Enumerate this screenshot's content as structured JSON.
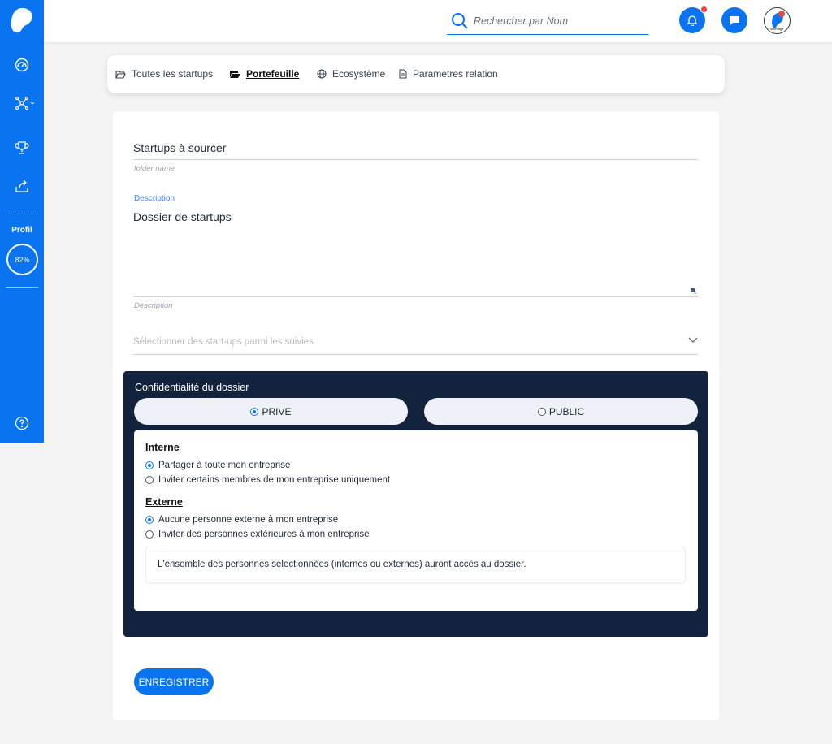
{
  "colors": {
    "brand_blue": "#0a73f0",
    "panel_navy": "#13233d",
    "notification_red": "#ef4444"
  },
  "sidebar": {
    "items": [
      {
        "icon": "dashboard-gauge-icon"
      },
      {
        "icon": "network-icon"
      },
      {
        "icon": "trophy-icon"
      },
      {
        "icon": "share-upload-icon"
      }
    ],
    "profile_label": "Profil",
    "profile_progress": "82%",
    "help_icon": "help-circle-icon"
  },
  "header": {
    "search": {
      "placeholder": "Rechercher par Nom",
      "value": ""
    },
    "avatar_text": "dorimage",
    "icons": [
      "search-icon",
      "bell-icon",
      "chat-icon"
    ]
  },
  "tabs": [
    {
      "label": "Toutes les startups",
      "icon": "folder-open-icon",
      "active": false
    },
    {
      "label": "Portefeuille",
      "icon": "folder-open-icon",
      "active": true
    },
    {
      "label": "Ecosystème",
      "icon": "globe-icon",
      "active": false
    },
    {
      "label": "Parametres relation",
      "icon": "document-icon",
      "active": false
    }
  ],
  "form": {
    "folder_name_value": "Startups à sourcer",
    "folder_name_hint": "folder name",
    "description_label": "Description",
    "description_value": "Dossier de startups",
    "description_hint": "Description",
    "select_placeholder": "Sélectionner des start-ups parmi les suivies"
  },
  "confidentiality": {
    "title": "Confidentialité du dossier",
    "options": [
      {
        "label": "PRIVE",
        "selected": true
      },
      {
        "label": "PUBLIC",
        "selected": false
      }
    ],
    "internal": {
      "heading": "Interne",
      "options": [
        {
          "label": "Partager à toute mon entreprise",
          "selected": true
        },
        {
          "label": "Inviter certains membres de mon entreprise uniquement",
          "selected": false
        }
      ]
    },
    "external": {
      "heading": "Externe",
      "options": [
        {
          "label": "Aucune personne externe à mon entreprise",
          "selected": true
        },
        {
          "label": "Inviter des personnes extérieures à mon entreprise",
          "selected": false
        }
      ]
    },
    "info": "L'ensemble des personnes sélectionnées (internes ou externes) auront accès au dossier."
  },
  "actions": {
    "save_label": "ENREGISTRER"
  }
}
